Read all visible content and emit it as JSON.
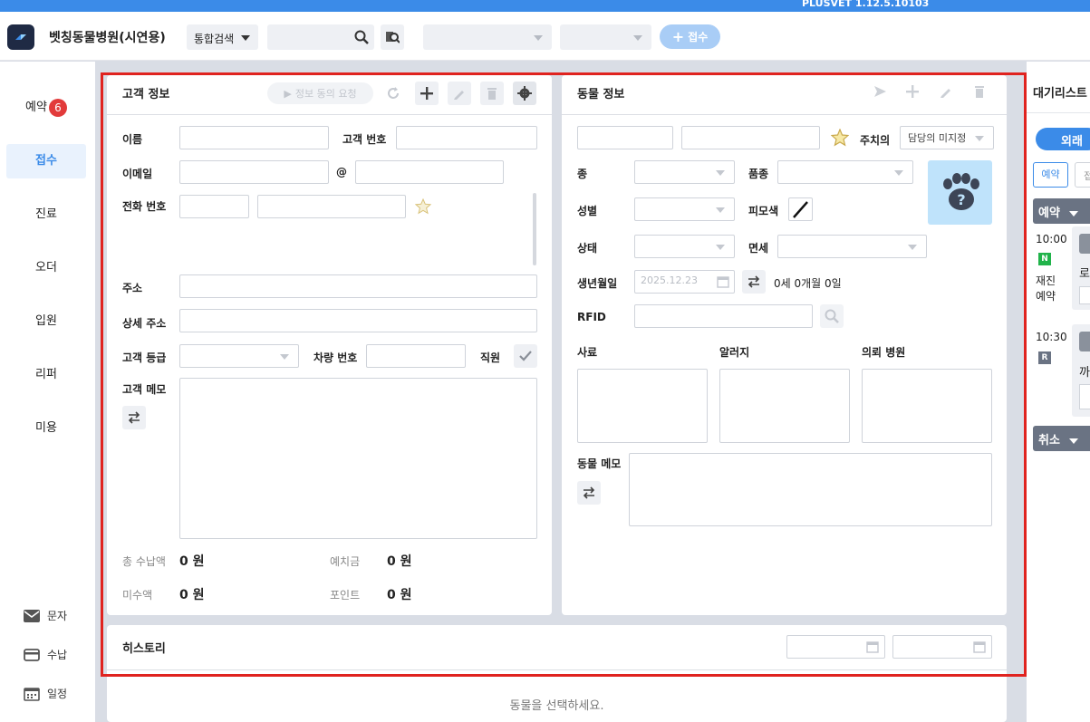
{
  "app": {
    "version": "PLUSVET 1.12.5.10103",
    "hospital_name": "벳칭동물병원(시연용)"
  },
  "header": {
    "search_type": "통합검색",
    "search_placeholder": "",
    "reception_button": "접수"
  },
  "sidebar": {
    "items": [
      {
        "label": "예약",
        "badge": "6"
      },
      {
        "label": "접수"
      },
      {
        "label": "진료"
      },
      {
        "label": "오더"
      },
      {
        "label": "입원"
      },
      {
        "label": "리퍼"
      },
      {
        "label": "미용"
      }
    ],
    "bottom": [
      {
        "label": "문자",
        "icon": "mail-icon"
      },
      {
        "label": "수납",
        "icon": "card-icon"
      },
      {
        "label": "일정",
        "icon": "calendar-icon"
      }
    ]
  },
  "customer": {
    "title": "고객 정보",
    "consent_button": "정보 동의 요청",
    "labels": {
      "name": "이름",
      "customer_no": "고객 번호",
      "email": "이메일",
      "at": "@",
      "phone": "전화 번호",
      "address": "주소",
      "address_detail": "상세 주소",
      "grade": "고객 등급",
      "car_no": "차량 번호",
      "staff": "직원",
      "memo": "고객 메모"
    },
    "summary": {
      "total_paid_label": "총 수납액",
      "total_paid": "0 원",
      "deposit_label": "예치금",
      "deposit": "0 원",
      "unpaid_label": "미수액",
      "unpaid": "0 원",
      "points_label": "포인트",
      "points": "0 원"
    }
  },
  "animal": {
    "title": "동물 정보",
    "labels": {
      "doctor": "주치의",
      "species": "종",
      "breed": "품종",
      "sex": "성별",
      "coat": "피모색",
      "status": "상태",
      "tax": "면세",
      "birth": "생년월일",
      "age": "0세 0개월 0일",
      "rfid": "RFID",
      "feed": "사료",
      "allergy": "알러지",
      "referral": "의뢰 병원",
      "memo": "동물 메모"
    },
    "doctor_value": "담당의 미지정",
    "birth_value": "2025.12.23"
  },
  "history": {
    "title": "히스토리",
    "empty": "동물을 선택하세요."
  },
  "waitlist": {
    "title": "대기리스트",
    "toggle": "외래",
    "tab1": "예약",
    "tab2": "접",
    "group_reservation": "예약",
    "group_cancel": "취소",
    "entries": [
      {
        "time": "10:00",
        "icon_letter": "N",
        "tag": "재진예약",
        "initial": "로"
      },
      {
        "time": "10:30",
        "icon_letter": "R",
        "tag": "",
        "initial": "까"
      }
    ]
  },
  "colors": {
    "accent": "#3b8be8",
    "badge": "#e23b3b",
    "highlight": "#e0231f"
  }
}
